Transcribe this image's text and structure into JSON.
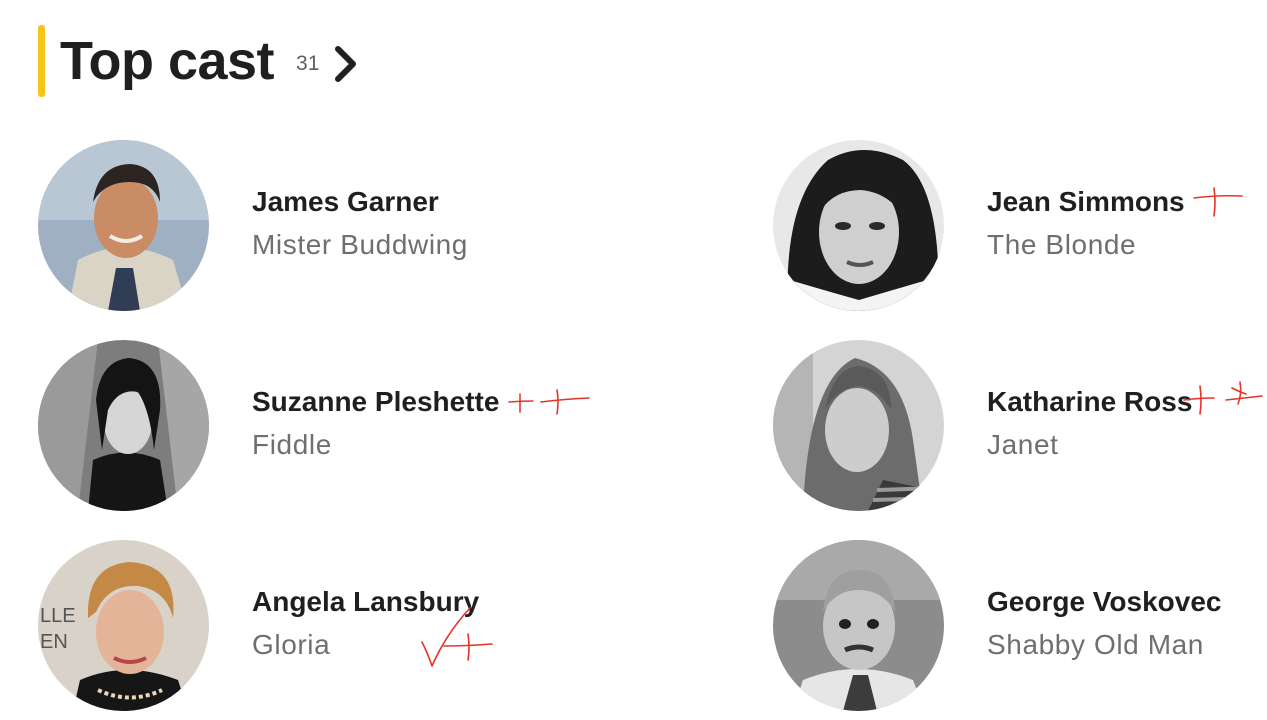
{
  "section": {
    "title": "Top cast",
    "count": "31",
    "accent_color": "#f5c518",
    "chevron_icon": "chevron-right-icon"
  },
  "cast": [
    {
      "actor": "James Garner",
      "role": "Mister Buddwing"
    },
    {
      "actor": "Jean Simmons",
      "role": "The Blonde"
    },
    {
      "actor": "Suzanne Pleshette",
      "role": "Fiddle"
    },
    {
      "actor": "Katharine Ross",
      "role": "Janet"
    },
    {
      "actor": "Angela Lansbury",
      "role": "Gloria"
    },
    {
      "actor": "George Voskovec",
      "role": "Shabby Old Man"
    }
  ],
  "annotations": {
    "ink_color": "#e5332a"
  }
}
